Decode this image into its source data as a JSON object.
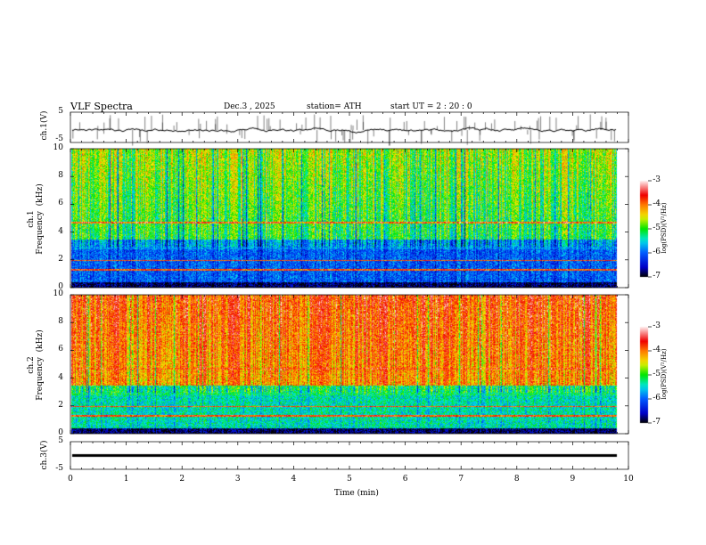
{
  "header": {
    "title": "VLF  Spectra",
    "date": "Dec.3  , 2025",
    "station": "station= ATH",
    "start": "start  UT  =   2  : 20 : 0"
  },
  "chart_data": [
    {
      "type": "line",
      "ylabel": "ch.1(V)",
      "ylim": [
        -5,
        5
      ],
      "yticks": [
        "5",
        "-5"
      ]
    },
    {
      "type": "heatmap",
      "ylabel": "ch.1\nFrequency  (kHz)",
      "ylim": [
        0,
        10
      ],
      "yticks": [
        "0",
        "2",
        "4",
        "6",
        "8",
        "10"
      ],
      "colorbar": {
        "label": "log(PSD)(V²/Hz)",
        "range": [
          -7,
          -3
        ],
        "ticks": [
          "-3",
          "-4",
          "-5",
          "-6",
          "-7"
        ]
      }
    },
    {
      "type": "heatmap",
      "ylabel": "ch.2\nFrequency  (kHz)",
      "ylim": [
        0,
        10
      ],
      "yticks": [
        "0",
        "2",
        "4",
        "6",
        "8",
        "10"
      ],
      "colorbar": {
        "label": "log(PSD)(V²/Hz)",
        "range": [
          -7,
          -3
        ],
        "ticks": [
          "-3",
          "-4",
          "-5",
          "-6",
          "-7"
        ]
      }
    },
    {
      "type": "line",
      "ylabel": "ch.3(V)",
      "ylim": [
        -5,
        5
      ],
      "yticks": [
        "5",
        "-5"
      ]
    }
  ],
  "xaxis": {
    "label": "Time  (min)",
    "xlim": [
      0,
      10
    ],
    "ticks": [
      "0",
      "1",
      "2",
      "3",
      "4",
      "5",
      "6",
      "7",
      "8",
      "9",
      "10"
    ]
  }
}
